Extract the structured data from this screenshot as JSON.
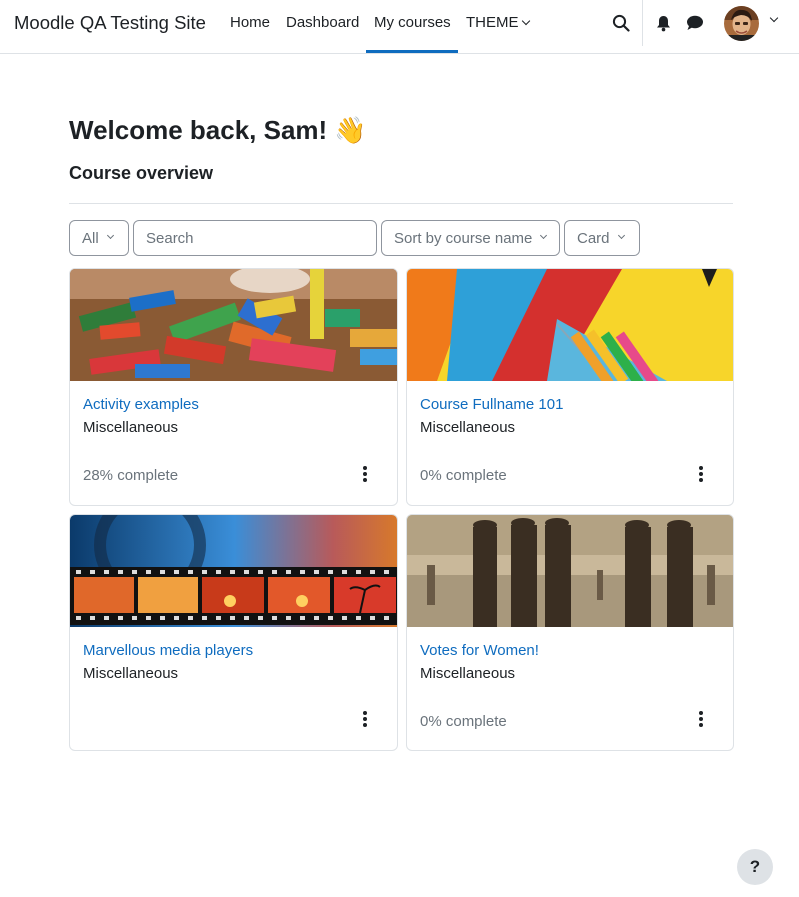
{
  "navbar": {
    "site_name": "Moodle QA Testing Site",
    "links": [
      {
        "label": "Home"
      },
      {
        "label": "Dashboard"
      },
      {
        "label": "My courses",
        "active": true
      },
      {
        "label": "THEME"
      }
    ],
    "icons": [
      "search-icon",
      "bell-icon",
      "chat-icon",
      "user-avatar",
      "chevron-down-icon"
    ],
    "accent_color": "#0f6cbf"
  },
  "main": {
    "welcome": "Welcome back, Sam!",
    "welcome_emoji": "👋",
    "section_title": "Course overview",
    "filters": {
      "grouping": "All",
      "search_placeholder": "Search",
      "sort": "Sort by course name",
      "view": "Card"
    },
    "courses": [
      {
        "title": "Activity examples",
        "category": "Miscellaneous",
        "progress": "28% complete",
        "image": "wooden-blocks"
      },
      {
        "title": "Course Fullname 101",
        "category": "Miscellaneous",
        "progress": "0% complete",
        "image": "stationery"
      },
      {
        "title": "Marvellous media players",
        "category": "Miscellaneous",
        "progress": "",
        "image": "film-strip"
      },
      {
        "title": "Votes for Women!",
        "category": "Miscellaneous",
        "progress": "0% complete",
        "image": "suffragettes-photo"
      }
    ]
  },
  "help": {
    "label": "?"
  },
  "colors": {
    "link": "#0f6cbf",
    "text": "#1d2125",
    "muted": "#6a737b",
    "border": "#dee2e6"
  }
}
